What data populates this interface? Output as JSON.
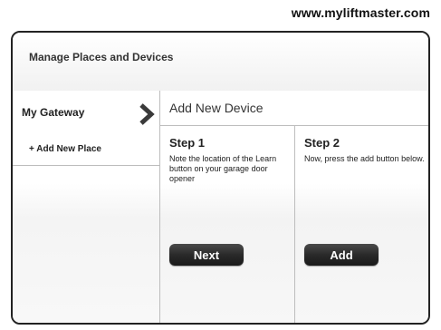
{
  "site": {
    "url": "www.myliftmaster.com"
  },
  "panel": {
    "title": "Manage Places and Devices"
  },
  "sidebar": {
    "items": [
      {
        "label": "My Gateway",
        "icon": "chevron-right-icon"
      },
      {
        "label": "+ Add New Place"
      }
    ]
  },
  "main": {
    "title": "Add New Device",
    "steps": [
      {
        "heading": "Step 1",
        "text": "Note the location of the Learn button on your garage door opener",
        "button_label": "Next"
      },
      {
        "heading": "Step 2",
        "text": "Now, press the add button below.",
        "button_label": "Add"
      }
    ]
  },
  "colors": {
    "border": "#222222",
    "button": "#2a2a2a",
    "divider": "#bdbdbd"
  }
}
